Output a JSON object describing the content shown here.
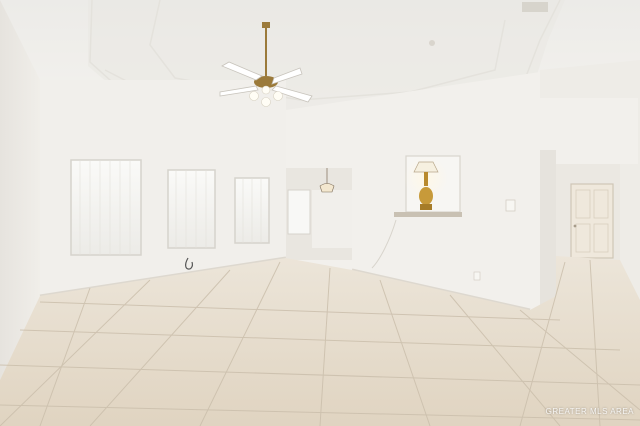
{
  "photo": {
    "subject": "empty-living-room",
    "watermark": "GREATER MLS AREA",
    "palette": {
      "wall": "#f1efeb",
      "ceiling": "#f3f1ee",
      "floor_tile": "#e6dccb",
      "grout": "#c9bca8",
      "window_blinds": "#f7f7f5",
      "door": "#efe8dc",
      "lamp": "#c79a3a"
    },
    "icons": {
      "ceiling_fan": "ceiling-fan-icon",
      "pendant_light": "pendant-light-icon",
      "table_lamp": "table-lamp-icon"
    }
  }
}
